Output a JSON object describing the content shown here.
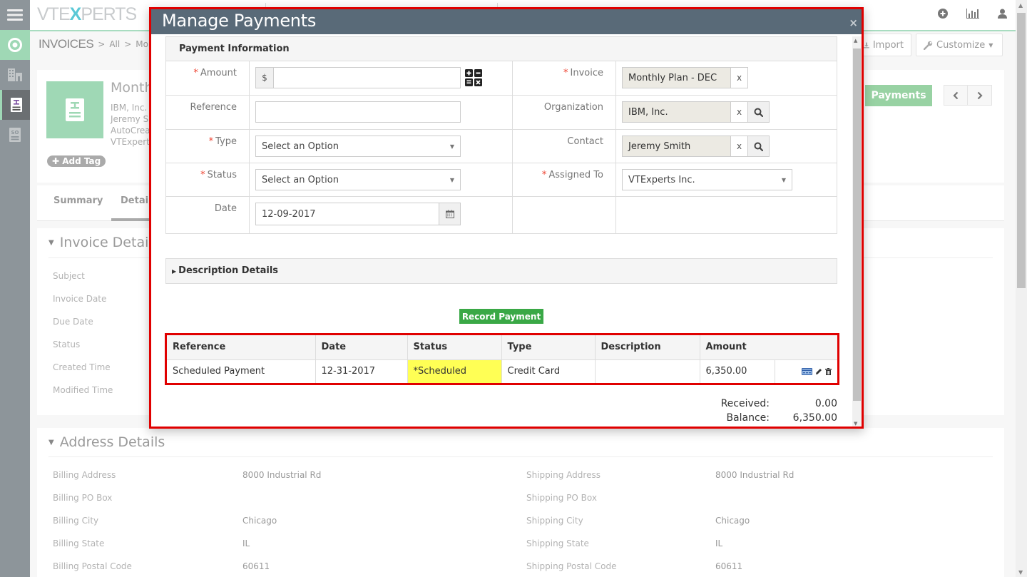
{
  "app": {
    "logo_prefix": "VTE",
    "logo_x": "X",
    "logo_suffix": "PERTS"
  },
  "sidebar": {
    "items": [
      {
        "name": "menu",
        "icon": "hamburger-icon"
      },
      {
        "name": "home",
        "icon": "target-icon"
      },
      {
        "name": "organizations",
        "icon": "building-icon"
      },
      {
        "name": "invoices",
        "icon": "invoice-icon",
        "active": true
      },
      {
        "name": "sales-orders",
        "icon": "so-icon",
        "label": "SO"
      }
    ]
  },
  "header": {
    "icons": [
      "plus-circle-icon",
      "bar-chart-icon",
      "user-icon"
    ]
  },
  "breadcrumb": {
    "module": "INVOICES",
    "sep": ">",
    "all": "All",
    "record": "Monthly P"
  },
  "toolbar": {
    "import_label": "Import",
    "customize_label": "Customize"
  },
  "record": {
    "title": "Month",
    "lines": [
      "IBM, Inc.",
      "Jeremy Sm",
      "AutoCrea",
      "VTExperts"
    ],
    "add_tag": "Add Tag",
    "payments_button": "Payments"
  },
  "tabs": [
    {
      "label": "Summary",
      "active": false
    },
    {
      "label": "Details",
      "active": true
    }
  ],
  "invoice_details": {
    "title": "Invoice Details",
    "fields": [
      "Subject",
      "Invoice Date",
      "Due Date",
      "Status",
      "Created Time",
      "Modified Time"
    ]
  },
  "address_details": {
    "title": "Address Details",
    "billing": [
      {
        "label": "Billing Address",
        "value": "8000 Industrial Rd"
      },
      {
        "label": "Billing PO Box",
        "value": ""
      },
      {
        "label": "Billing City",
        "value": "Chicago"
      },
      {
        "label": "Billing State",
        "value": "IL"
      },
      {
        "label": "Billing Postal Code",
        "value": "60611"
      }
    ],
    "shipping": [
      {
        "label": "Shipping Address",
        "value": "8000 Industrial Rd"
      },
      {
        "label": "Shipping PO Box",
        "value": ""
      },
      {
        "label": "Shipping City",
        "value": "Chicago"
      },
      {
        "label": "Shipping State",
        "value": "IL"
      },
      {
        "label": "Shipping Postal Code",
        "value": "60611"
      }
    ]
  },
  "modal": {
    "title": "Manage Payments",
    "close": "×",
    "section_title": "Payment Information",
    "form": {
      "amount": {
        "label": "Amount",
        "required": true,
        "prefix": "$",
        "value": ""
      },
      "reference": {
        "label": "Reference",
        "required": false,
        "value": ""
      },
      "type": {
        "label": "Type",
        "required": true,
        "value": "Select an Option"
      },
      "status": {
        "label": "Status",
        "required": true,
        "value": "Select an Option"
      },
      "date": {
        "label": "Date",
        "required": false,
        "value": "12-09-2017"
      },
      "invoice": {
        "label": "Invoice",
        "required": true,
        "value": "Monthly Plan - DEC",
        "clear": "x"
      },
      "organization": {
        "label": "Organization",
        "required": false,
        "value": "IBM, Inc.",
        "clear": "x"
      },
      "contact": {
        "label": "Contact",
        "required": false,
        "value": "Jeremy Smith",
        "clear": "x"
      },
      "assigned_to": {
        "label": "Assigned To",
        "required": true,
        "value": "VTExperts Inc."
      }
    },
    "required_mark": "*",
    "description_section": "Description Details",
    "record_payment_button": "Record Payment",
    "table": {
      "columns": [
        "Reference",
        "Date",
        "Status",
        "Type",
        "Description",
        "Amount",
        ""
      ],
      "rows": [
        {
          "reference": "Scheduled Payment",
          "date": "12-31-2017",
          "status": "*Scheduled",
          "type": "Credit Card",
          "description": "",
          "amount": "6,350.00",
          "actions": [
            "credit-card-icon",
            "pencil-icon",
            "trash-icon"
          ]
        }
      ]
    },
    "totals": {
      "received_label": "Received:",
      "received_value": "0.00",
      "balance_label": "Balance:",
      "balance_value": "6,350.00"
    }
  },
  "colors": {
    "accent_green": "#9fd8b5",
    "modal_header": "#596a78",
    "record_btn": "#3aa846",
    "highlight_border": "#e00000",
    "status_highlight": "#ffff55"
  }
}
